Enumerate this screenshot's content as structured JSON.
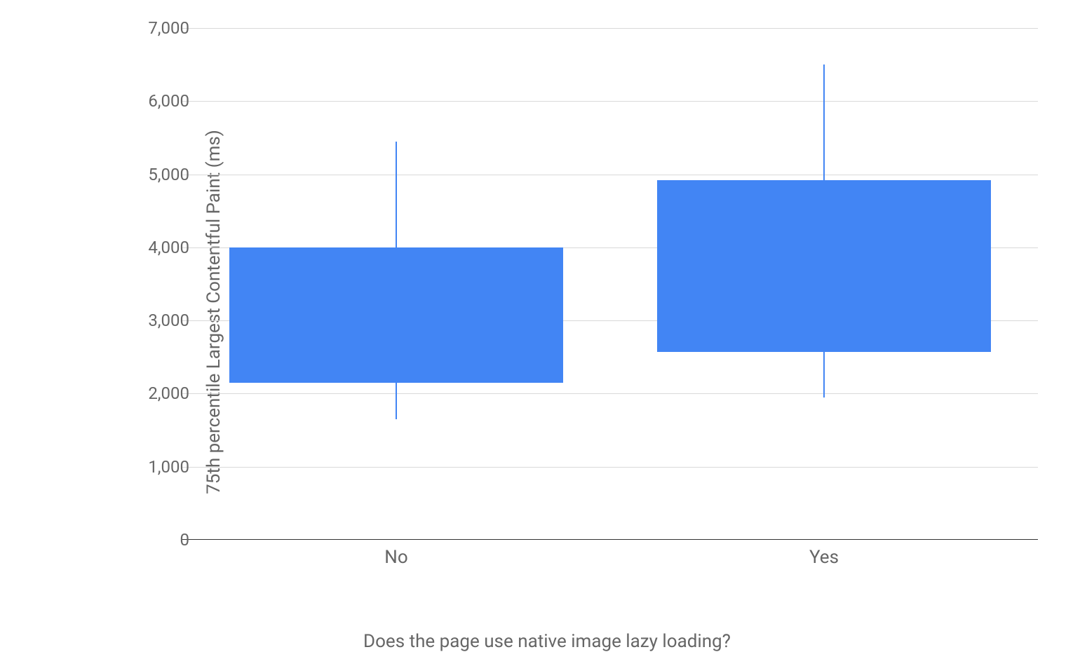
{
  "chart_data": {
    "type": "boxplot",
    "xlabel": "Does the page use native image lazy loading?",
    "ylabel": "75th percentile Largest Contentful Paint (ms)",
    "categories": [
      "No",
      "Yes"
    ],
    "ylim": [
      0,
      7000
    ],
    "y_ticks": [
      0,
      1000,
      2000,
      3000,
      4000,
      5000,
      6000,
      7000
    ],
    "y_tick_labels": [
      "0",
      "1,000",
      "2,000",
      "3,000",
      "4,000",
      "5,000",
      "6,000",
      "7,000"
    ],
    "series": [
      {
        "name": "No",
        "whisker_low": 1650,
        "q1": 2150,
        "q3": 4000,
        "whisker_high": 5450
      },
      {
        "name": "Yes",
        "whisker_low": 1950,
        "q1": 2570,
        "q3": 4920,
        "whisker_high": 6500
      }
    ],
    "box_color": "#4285f4"
  }
}
